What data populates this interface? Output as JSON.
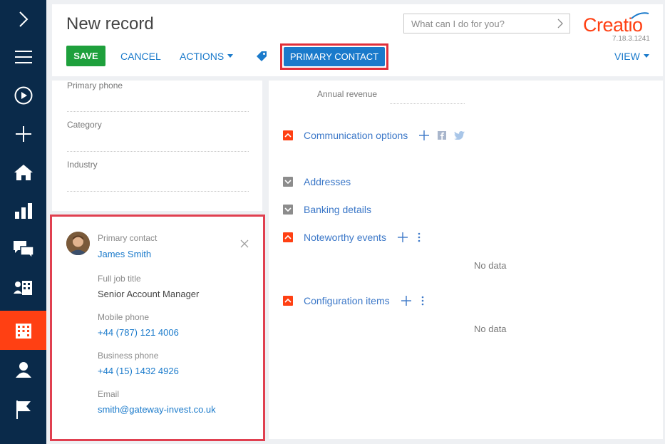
{
  "sidebar": {
    "items": [
      {
        "icon": "chevron-right-icon",
        "active": false
      },
      {
        "icon": "hamburger-menu-icon",
        "active": false
      },
      {
        "icon": "play-circle-icon",
        "active": false
      },
      {
        "icon": "plus-icon",
        "active": false
      },
      {
        "icon": "home-icon",
        "active": false
      },
      {
        "icon": "bar-chart-icon",
        "active": false
      },
      {
        "icon": "chat-icon",
        "active": false
      },
      {
        "icon": "accounts-icon",
        "active": false
      },
      {
        "icon": "building-icon",
        "active": true
      },
      {
        "icon": "contact-person-icon",
        "active": false
      },
      {
        "icon": "flag-icon",
        "active": false
      }
    ]
  },
  "header": {
    "title": "New record",
    "search_placeholder": "What can I do for you?",
    "logo": "Creatio",
    "version": "7.18.3.1241",
    "save_label": "SAVE",
    "cancel_label": "CANCEL",
    "actions_label": "ACTIONS",
    "primary_contact_label": "PRIMARY CONTACT",
    "view_label": "VIEW"
  },
  "left_fields": {
    "primary_phone_label": "Primary phone",
    "category_label": "Category",
    "industry_label": "Industry"
  },
  "contact_card": {
    "primary_contact_label": "Primary contact",
    "primary_contact_name": "James Smith",
    "job_title_label": "Full job title",
    "job_title_value": "Senior Account Manager",
    "mobile_label": "Mobile phone",
    "mobile_value": "+44 (787) 121 4006",
    "business_label": "Business phone",
    "business_value": "+44 (15) 1432 4926",
    "email_label": "Email",
    "email_value": "smith@gateway-invest.co.uk"
  },
  "right_panel": {
    "annual_revenue_label": "Annual revenue",
    "groups": {
      "communication": "Communication options",
      "addresses": "Addresses",
      "banking": "Banking details",
      "noteworthy": "Noteworthy events",
      "configuration": "Configuration items"
    },
    "no_data_1": "No data",
    "no_data_2": "No data"
  },
  "colors": {
    "sidebar_bg": "#0a2a4a",
    "accent_orange": "#ff4013",
    "link_blue": "#1a7acb",
    "save_green": "#1ea03c",
    "highlight_red": "#e04050"
  }
}
